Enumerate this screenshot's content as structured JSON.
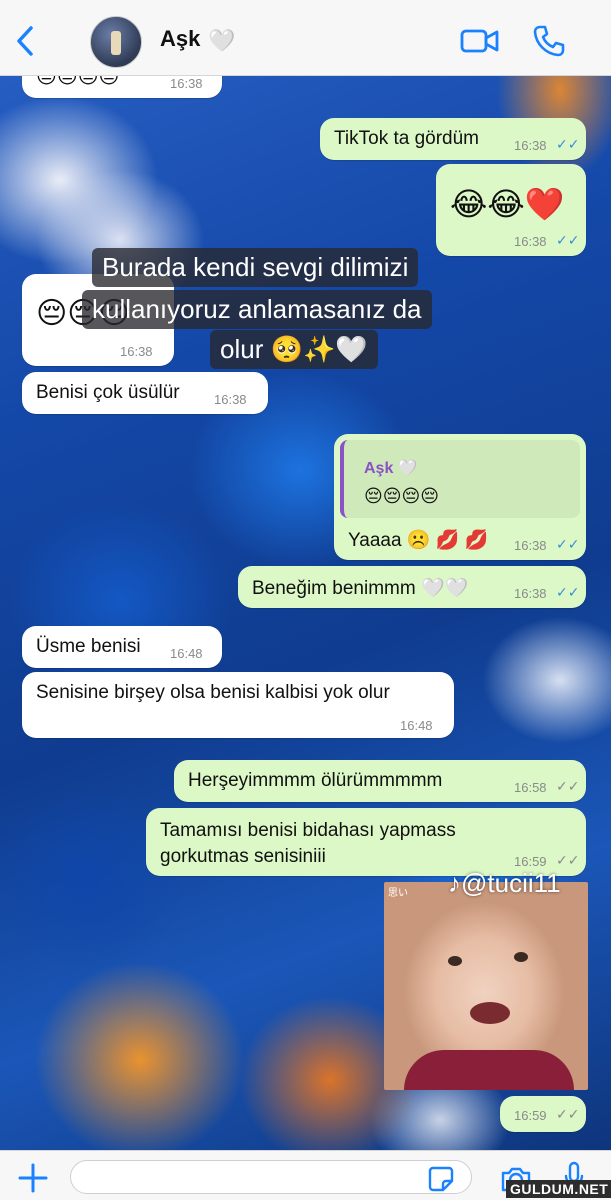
{
  "header": {
    "contact_name": "Aşk",
    "contact_emoji": "🤍"
  },
  "messages": [
    {
      "id": "m0",
      "dir": "in",
      "text": "😔😔😔😔",
      "time": "16:38"
    },
    {
      "id": "m1",
      "dir": "out",
      "text": "TikTok ta gördüm",
      "time": "16:38",
      "status": "read"
    },
    {
      "id": "m2",
      "dir": "out",
      "text": "😂😂❤️",
      "time": "16:38",
      "status": "read"
    },
    {
      "id": "m3",
      "dir": "in",
      "text": "😔😔😔",
      "time": "16:38"
    },
    {
      "id": "m4",
      "dir": "in",
      "text": "Benisi çok üsülür",
      "time": "16:38"
    },
    {
      "id": "m5",
      "dir": "out",
      "quote_author": "Aşk 🤍",
      "quote_text": "😔😔😔😔",
      "text": "Yaaaa ☹️ 💋 💋",
      "time": "16:38",
      "status": "read"
    },
    {
      "id": "m6",
      "dir": "out",
      "text": "Beneğim benimmm 🤍🤍",
      "time": "16:38",
      "status": "read"
    },
    {
      "id": "m7",
      "dir": "in",
      "text": "Üsme benisi",
      "time": "16:48"
    },
    {
      "id": "m8",
      "dir": "in",
      "text": "Senisine birşey olsa benisi kalbisi yok olur",
      "time": "16:48"
    },
    {
      "id": "m9",
      "dir": "out",
      "text": "Herşeyimmmm ölürümmmmm",
      "time": "16:58",
      "status": "delivered"
    },
    {
      "id": "m10",
      "dir": "out",
      "line1": "Tamamısı benisi bidahası yapmass",
      "line2": "gorkutmas senisiniii",
      "time": "16:59",
      "status": "delivered"
    },
    {
      "id": "m11",
      "dir": "out",
      "type": "sticker",
      "time": "16:59",
      "status": "delivered"
    }
  ],
  "overlay_caption": {
    "line1": "Burada kendi sevgi dilimizi",
    "line2": "kullanıyoruz anlamasanız da",
    "line3": "olur 🥺✨🤍"
  },
  "sticker": {
    "tag": "思い"
  },
  "tiktok_handle": "@tucii11",
  "watermark": "GULDUM.NET",
  "colors": {
    "outgoing_bubble": "#dcf8c6",
    "incoming_bubble": "#ffffff",
    "accent_blue": "#1a82ff",
    "read_check": "#3b8fdc"
  }
}
